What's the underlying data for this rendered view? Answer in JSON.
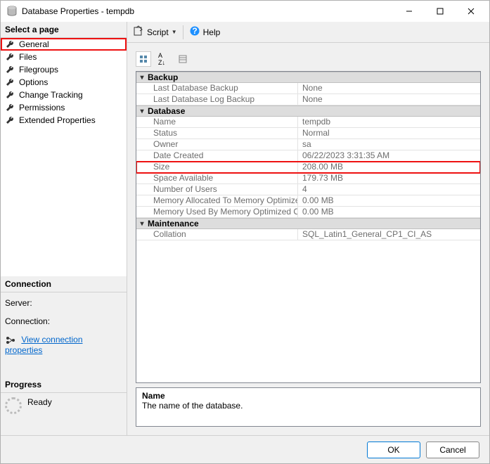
{
  "window": {
    "title": "Database Properties - tempdb"
  },
  "left": {
    "select_page_header": "Select a page",
    "pages": [
      "General",
      "Files",
      "Filegroups",
      "Options",
      "Change Tracking",
      "Permissions",
      "Extended Properties"
    ],
    "connection_header": "Connection",
    "server_label": "Server:",
    "connection_label": "Connection:",
    "view_conn_link": "View connection properties",
    "progress_header": "Progress",
    "progress_text": "Ready"
  },
  "toolbar": {
    "script": "Script",
    "help": "Help"
  },
  "grid": {
    "cat_backup": "Backup",
    "backup": {
      "last_backup_label": "Last Database Backup",
      "last_backup_value": "None",
      "last_log_backup_label": "Last Database Log Backup",
      "last_log_backup_value": "None"
    },
    "cat_database": "Database",
    "database": {
      "name_label": "Name",
      "name_value": "tempdb",
      "status_label": "Status",
      "status_value": "Normal",
      "owner_label": "Owner",
      "owner_value": "sa",
      "date_created_label": "Date Created",
      "date_created_value": "06/22/2023 3:31:35 AM",
      "size_label": "Size",
      "size_value": "208.00 MB",
      "space_label": "Space Available",
      "space_value": "179.73 MB",
      "users_label": "Number of Users",
      "users_value": "4",
      "mem_alloc_label": "Memory Allocated To Memory Optimized Obje",
      "mem_alloc_value": "0.00 MB",
      "mem_used_label": "Memory Used By Memory Optimized Objects",
      "mem_used_value": "0.00 MB"
    },
    "cat_maintenance": "Maintenance",
    "maintenance": {
      "collation_label": "Collation",
      "collation_value": "SQL_Latin1_General_CP1_CI_AS"
    }
  },
  "desc": {
    "name": "Name",
    "text": "The name of the database."
  },
  "buttons": {
    "ok": "OK",
    "cancel": "Cancel"
  }
}
